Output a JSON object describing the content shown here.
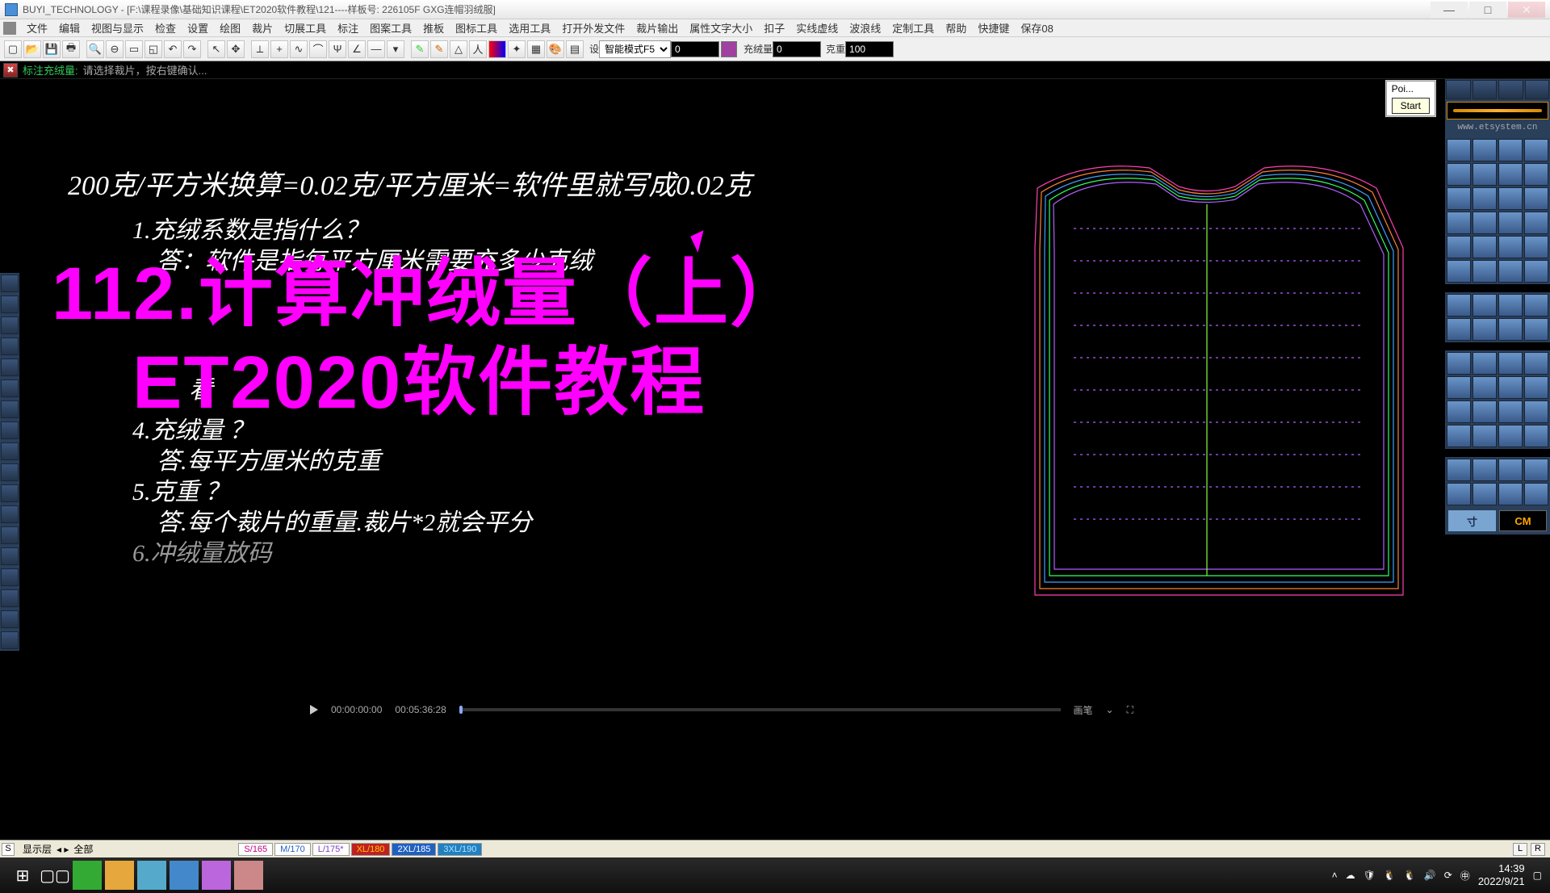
{
  "title": "BUYI_TECHNOLOGY - [F:\\课程录像\\基础知识课程\\ET2020软件教程\\121----样板号: 226105F  GXG连帽羽绒服]",
  "tooltip": {
    "l1": "Poi...",
    "l2": "Start"
  },
  "menu": [
    "文件",
    "编辑",
    "视图与显示",
    "检查",
    "设置",
    "绘图",
    "裁片",
    "切展工具",
    "标注",
    "图案工具",
    "推板",
    "图标工具",
    "选用工具",
    "打开外发文件",
    "裁片输出",
    "属性文字大小",
    "扣子",
    "实线虚线",
    "波浪线",
    "定制工具",
    "帮助",
    "快捷键",
    "保存08"
  ],
  "toolbar": {
    "mode_label": "设",
    "mode_select": "智能模式F5",
    "val1": "0",
    "rlabel": "充绒量",
    "rval": "0",
    "wlabel": "克重",
    "wval": "100"
  },
  "status": {
    "label": "标注充绒量:",
    "text": "请选择裁片，按右键确认..."
  },
  "url": "www.etsystem.cn",
  "cm": {
    "inch": "寸",
    "cm": "CM"
  },
  "canvas_text": {
    "top": "200克/平方米换算=0.02克/平方厘米=软件里就写成0.02克",
    "q1": "1.充绒系数是指什么？",
    "a1": "答：软件是指每平方厘米需要充多少克绒",
    "q2b": "看",
    "q4": "4.充绒量  ？",
    "a4": "答.每平方厘米的克重",
    "q5": "5.克重  ？",
    "a5": "答.每个裁片的重量.裁片*2就会平分",
    "q6": "6.冲绒量放码"
  },
  "overlay": {
    "l1": "112.计算冲绒量（上）",
    "l2": "ET2020软件教程"
  },
  "player": {
    "t1": "00:00:00:00",
    "t2": "00:05:36:28",
    "rb": "画笔"
  },
  "bottom": {
    "s": "S",
    "lab": "显示层",
    "all": "全部"
  },
  "sizes": [
    {
      "t": "S/165",
      "bg": "#fff",
      "fg": "#c00080"
    },
    {
      "t": "M/170",
      "bg": "#fff",
      "fg": "#2060c0"
    },
    {
      "t": "L/175*",
      "bg": "#fff",
      "fg": "#8040c0"
    },
    {
      "t": "XL/180",
      "bg": "#c02020",
      "fg": "#ffcc00"
    },
    {
      "t": "2XL/185",
      "bg": "#2060c0",
      "fg": "#fff"
    },
    {
      "t": "3XL/190",
      "bg": "#2080c0",
      "fg": "#b0e0ff"
    }
  ],
  "lr": {
    "l": "L",
    "r": "R"
  },
  "clock": {
    "time": "14:39",
    "date": "2022/9/21"
  }
}
